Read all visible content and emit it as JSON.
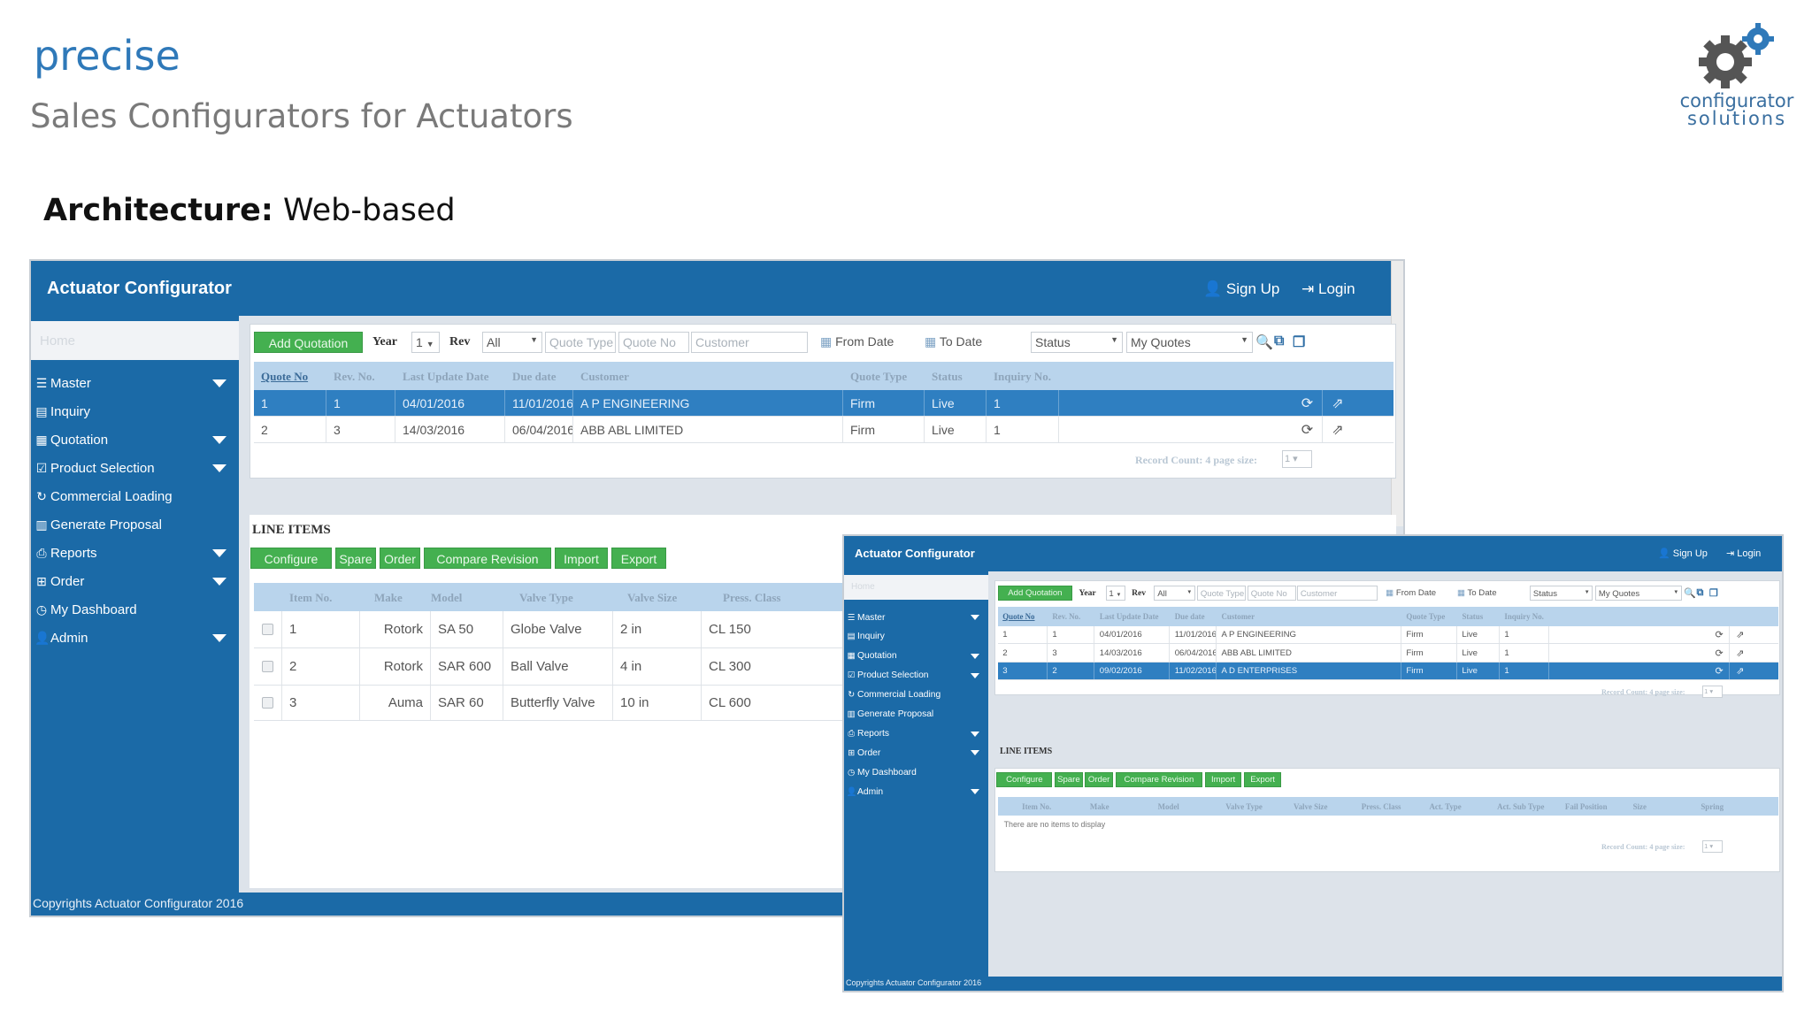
{
  "slide": {
    "brand": "precise",
    "subtitle": "Sales Configurators for Actuators",
    "arch_label": "Architecture:",
    "arch_value": "Web-based",
    "logo_line1": "configurator",
    "logo_line2": "solutions"
  },
  "colors": {
    "accent": "#2f79b9",
    "app_blue": "#1b6aa7",
    "green_button": "#44b050",
    "row_selected": "#2f7fc1"
  },
  "app1": {
    "title": "Actuator Configurator",
    "signup": "Sign Up",
    "login": "Login",
    "sidebar_home": "Home",
    "sidebar": [
      {
        "label": "Master",
        "icon": "list-icon",
        "caret": true
      },
      {
        "label": "Inquiry",
        "icon": "inquiry-icon",
        "caret": false
      },
      {
        "label": "Quotation",
        "icon": "table-icon",
        "caret": true
      },
      {
        "label": "Product Selection",
        "icon": "check-square-icon",
        "caret": true
      },
      {
        "label": "Commercial Loading",
        "icon": "refresh-icon",
        "caret": false
      },
      {
        "label": "Generate Proposal",
        "icon": "grid-icon",
        "caret": false
      },
      {
        "label": "Reports",
        "icon": "print-icon",
        "caret": true
      },
      {
        "label": "Order",
        "icon": "sitemap-icon",
        "caret": true
      },
      {
        "label": "My Dashboard",
        "icon": "clock-icon",
        "caret": false
      },
      {
        "label": "Admin",
        "icon": "user-icon",
        "caret": true
      }
    ],
    "toolbar": {
      "add_quotation": "Add Quotation",
      "year_label": "Year",
      "year_value": "1",
      "rev_label": "Rev",
      "rev_value": "All",
      "quote_type_ph": "Quote Type",
      "quote_no_ph": "Quote No",
      "customer_ph": "Customer",
      "from_date": "From Date",
      "to_date": "To Date",
      "status": "Status",
      "my_quotes": "My Quotes"
    },
    "quotes": {
      "columns": [
        "Quote No",
        "Rev. No.",
        "Last Update Date",
        "Due date",
        "Customer",
        "Quote Type",
        "Status",
        "Inquiry No."
      ],
      "rows": [
        [
          "1",
          "1",
          "04/01/2016",
          "11/01/2016",
          "A P ENGINEERING",
          "Firm",
          "Live",
          "1"
        ],
        [
          "2",
          "3",
          "14/03/2016",
          "06/04/2016",
          "ABB ABL LIMITED",
          "Firm",
          "Live",
          "1"
        ]
      ],
      "record_count": "Record Count: 4 page size:",
      "page_size": "1"
    },
    "line_items": {
      "title": "LINE ITEMS",
      "buttons": [
        "Configure",
        "Spare",
        "Order",
        "Compare Revision",
        "Import",
        "Export"
      ],
      "columns": [
        "Item No.",
        "Make",
        "Model",
        "Valve Type",
        "Valve Size",
        "Press. Class"
      ],
      "rows": [
        [
          "1",
          "Rotork",
          "SA 50",
          "Globe Valve",
          "2 in",
          "CL 150"
        ],
        [
          "2",
          "Rotork",
          "SAR 600",
          "Ball Valve",
          "4 in",
          "CL 300"
        ],
        [
          "3",
          "Auma",
          "SAR 60",
          "Butterfly Valve",
          "10 in",
          "CL 600"
        ]
      ]
    },
    "footer": "Copyrights Actuator Configurator 2016"
  },
  "app2": {
    "title": "Actuator Configurator",
    "signup": "Sign Up",
    "login": "Login",
    "sidebar_home": "Home",
    "sidebar": [
      {
        "label": "Master",
        "icon": "list-icon",
        "caret": true
      },
      {
        "label": "Inquiry",
        "icon": "inquiry-icon",
        "caret": false
      },
      {
        "label": "Quotation",
        "icon": "table-icon",
        "caret": true
      },
      {
        "label": "Product Selection",
        "icon": "check-square-icon",
        "caret": true
      },
      {
        "label": "Commercial Loading",
        "icon": "refresh-icon",
        "caret": false
      },
      {
        "label": "Generate Proposal",
        "icon": "grid-icon",
        "caret": false
      },
      {
        "label": "Reports",
        "icon": "print-icon",
        "caret": true
      },
      {
        "label": "Order",
        "icon": "sitemap-icon",
        "caret": true
      },
      {
        "label": "My Dashboard",
        "icon": "clock-icon",
        "caret": false
      },
      {
        "label": "Admin",
        "icon": "user-icon",
        "caret": true
      }
    ],
    "toolbar": {
      "add_quotation": "Add Quotation",
      "year_label": "Year",
      "year_value": "1",
      "rev_label": "Rev",
      "rev_value": "All",
      "quote_type_ph": "Quote Type",
      "quote_no_ph": "Quote No",
      "customer_ph": "Customer",
      "from_date": "From Date",
      "to_date": "To Date",
      "status": "Status",
      "my_quotes": "My Quotes"
    },
    "quotes": {
      "columns": [
        "Quote No",
        "Rev. No.",
        "Last Update Date",
        "Due date",
        "Customer",
        "Quote Type",
        "Status",
        "Inquiry No."
      ],
      "rows": [
        [
          "1",
          "1",
          "04/01/2016",
          "11/01/2016",
          "A P ENGINEERING",
          "Firm",
          "Live",
          "1"
        ],
        [
          "2",
          "3",
          "14/03/2016",
          "06/04/2016",
          "ABB ABL LIMITED",
          "Firm",
          "Live",
          "1"
        ],
        [
          "3",
          "2",
          "09/02/2016",
          "11/02/2016",
          "A D ENTERPRISES",
          "Firm",
          "Live",
          "1"
        ]
      ],
      "record_count": "Record Count: 4 page size:",
      "page_size": "1"
    },
    "line_items": {
      "title": "LINE ITEMS",
      "buttons": [
        "Configure",
        "Spare",
        "Order",
        "Compare Revision",
        "Import",
        "Export"
      ],
      "columns": [
        "Item No.",
        "Make",
        "Model",
        "Valve Type",
        "Valve Size",
        "Press. Class",
        "Act. Type",
        "Act. Sub Type",
        "Fail Position",
        "Size",
        "Spring"
      ],
      "empty": "There are no items to display",
      "record_count": "Record Count: 4 page size:",
      "page_size": "1"
    },
    "footer": "Copyrights Actuator Configurator 2016"
  }
}
